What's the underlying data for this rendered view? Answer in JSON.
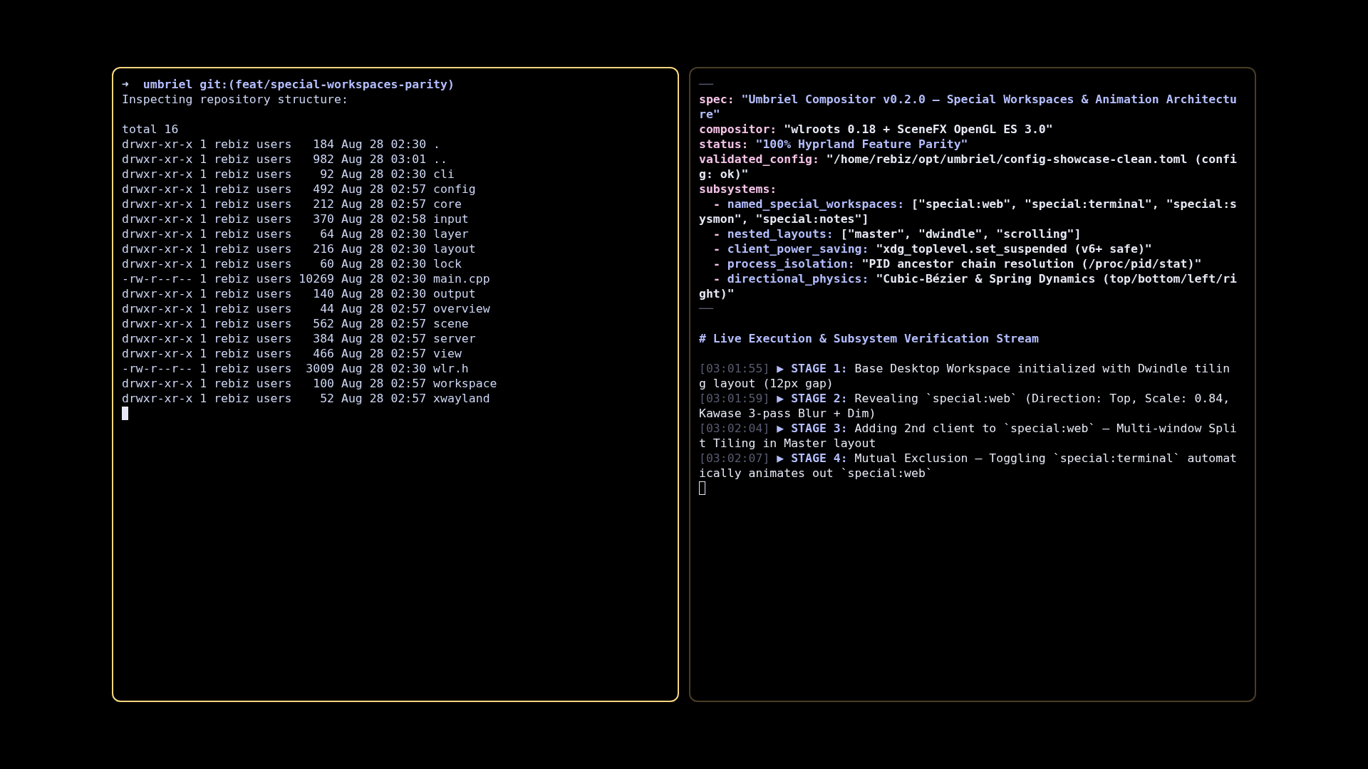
{
  "panes": [
    {
      "focused": true,
      "cursor_filled": true,
      "lines": [
        {
          "kind": "prompt",
          "arrow": "➜",
          "text": "umbriel git:(feat/special-workspaces-parity)"
        },
        {
          "kind": "text",
          "text": "Inspecting repository structure:"
        },
        {
          "kind": "blank"
        },
        {
          "kind": "text",
          "text": "total 16"
        },
        {
          "kind": "text",
          "text": "drwxr-xr-x 1 rebiz users   184 Aug 28 02:30 ."
        },
        {
          "kind": "text",
          "text": "drwxr-xr-x 1 rebiz users   982 Aug 28 03:01 .."
        },
        {
          "kind": "text",
          "text": "drwxr-xr-x 1 rebiz users    92 Aug 28 02:30 cli"
        },
        {
          "kind": "text",
          "text": "drwxr-xr-x 1 rebiz users   492 Aug 28 02:57 config"
        },
        {
          "kind": "text",
          "text": "drwxr-xr-x 1 rebiz users   212 Aug 28 02:57 core"
        },
        {
          "kind": "text",
          "text": "drwxr-xr-x 1 rebiz users   370 Aug 28 02:58 input"
        },
        {
          "kind": "text",
          "text": "drwxr-xr-x 1 rebiz users    64 Aug 28 02:30 layer"
        },
        {
          "kind": "text",
          "text": "drwxr-xr-x 1 rebiz users   216 Aug 28 02:30 layout"
        },
        {
          "kind": "text",
          "text": "drwxr-xr-x 1 rebiz users    60 Aug 28 02:30 lock"
        },
        {
          "kind": "text",
          "text": "-rw-r--r-- 1 rebiz users 10269 Aug 28 02:30 main.cpp"
        },
        {
          "kind": "text",
          "text": "drwxr-xr-x 1 rebiz users   140 Aug 28 02:30 output"
        },
        {
          "kind": "text",
          "text": "drwxr-xr-x 1 rebiz users    44 Aug 28 02:57 overview"
        },
        {
          "kind": "text",
          "text": "drwxr-xr-x 1 rebiz users   562 Aug 28 02:57 scene"
        },
        {
          "kind": "text",
          "text": "drwxr-xr-x 1 rebiz users   384 Aug 28 02:57 server"
        },
        {
          "kind": "text",
          "text": "drwxr-xr-x 1 rebiz users   466 Aug 28 02:57 view"
        },
        {
          "kind": "text",
          "text": "-rw-r--r-- 1 rebiz users  3009 Aug 28 02:30 wlr.h"
        },
        {
          "kind": "text",
          "text": "drwxr-xr-x 1 rebiz users   100 Aug 28 02:57 workspace"
        },
        {
          "kind": "text",
          "text": "drwxr-xr-x 1 rebiz users    52 Aug 28 02:57 xwayland"
        }
      ]
    },
    {
      "focused": false,
      "cursor_filled": false,
      "lines": [
        {
          "kind": "rule",
          "text": "──"
        },
        {
          "kind": "entry",
          "key": "spec:",
          "value": "\"Umbriel Compositor v0.2.0 — Special Workspaces & Animation Architecture\"",
          "highlighted": true
        },
        {
          "kind": "entry",
          "key": "compositor:",
          "value": "\"wlroots 0.18 + SceneFX OpenGL ES 3.0\"",
          "highlighted": false
        },
        {
          "kind": "entry",
          "key": "status:",
          "value": "\"100% Hyprland Feature Parity\"",
          "highlighted": true
        },
        {
          "kind": "entry",
          "key": "validated_config:",
          "value": "\"/home/rebiz/opt/umbriel/config-showcase-clean.toml (config: ok)\"",
          "highlighted": false
        },
        {
          "kind": "entry",
          "key": "subsystems:"
        },
        {
          "kind": "item",
          "bullet": "-",
          "key": "named_special_workspaces:",
          "value": "[\"special:web\", \"special:terminal\", \"special:sysmon\", \"special:notes\"]"
        },
        {
          "kind": "item",
          "bullet": "-",
          "key": "nested_layouts:",
          "value": "[\"master\", \"dwindle\", \"scrolling\"]"
        },
        {
          "kind": "item",
          "bullet": "-",
          "key": "client_power_saving:",
          "value": "\"xdg_toplevel.set_suspended (v6+ safe)\""
        },
        {
          "kind": "item",
          "bullet": "-",
          "key": "process_isolation:",
          "value": "\"PID ancestor chain resolution (/proc/pid/stat)\""
        },
        {
          "kind": "item",
          "bullet": "-",
          "key": "directional_physics:",
          "value": "\"Cubic-Bézier & Spring Dynamics (top/bottom/left/right)\""
        },
        {
          "kind": "rule",
          "text": "──"
        },
        {
          "kind": "blank"
        },
        {
          "kind": "heading",
          "text": "# Live Execution & Subsystem Verification Stream"
        },
        {
          "kind": "blank"
        },
        {
          "kind": "log",
          "time": "[03:01:55]",
          "marker": "▶",
          "stage": "STAGE 1:",
          "text": "Base Desktop Workspace initialized with Dwindle tiling layout (12px gap)"
        },
        {
          "kind": "log",
          "time": "[03:01:59]",
          "marker": "▶",
          "stage": "STAGE 2:",
          "text": "Revealing `special:web` (Direction: Top, Scale: 0.84, Kawase 3-pass Blur + Dim)"
        },
        {
          "kind": "log",
          "time": "[03:02:04]",
          "marker": "▶",
          "stage": "STAGE 3:",
          "text": "Adding 2nd client to `special:web` — Multi-window Split Tiling in Master layout"
        },
        {
          "kind": "log",
          "time": "[03:02:07]",
          "marker": "▶",
          "stage": "STAGE 4:",
          "text": "Mutual Exclusion — Toggling `special:terminal` automatically animates out `special:web`"
        }
      ]
    }
  ]
}
